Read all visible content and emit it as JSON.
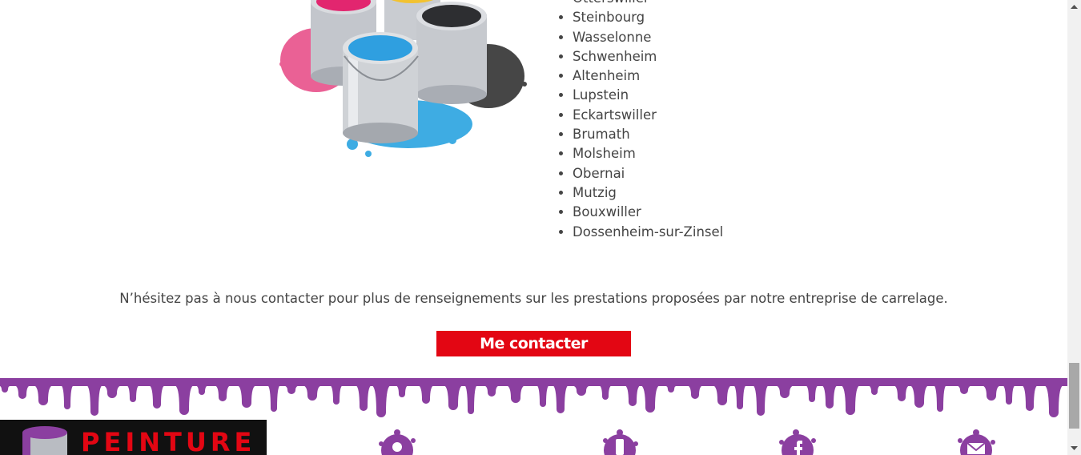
{
  "cities": [
    "Otterswiller",
    "Steinbourg",
    "Wasselonne",
    "Schwenheim",
    "Altenheim",
    "Lupstein",
    "Eckartswiller",
    "Brumath",
    "Molsheim",
    "Obernai",
    "Mutzig",
    "Bouxwiller",
    "Dossenheim-sur-Zinsel"
  ],
  "contact": {
    "text": "N’hésitez pas à nous contacter pour plus de renseignements sur les prestations proposées par notre entreprise de carrelage.",
    "button_label": "Me contacter"
  },
  "footer": {
    "logo_text": "PEINTURE",
    "icons": [
      "location-icon",
      "phone-icon",
      "facebook-icon",
      "email-icon"
    ]
  },
  "colors": {
    "accent_red": "#e30613",
    "footer_purple": "#8b3fa0",
    "logo_bg": "#111111"
  }
}
